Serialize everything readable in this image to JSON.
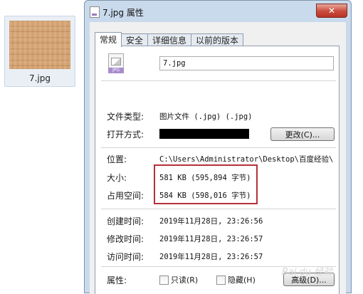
{
  "desktop": {
    "thumbnail_label": "7.jpg"
  },
  "window": {
    "title": "7.jpg 属性",
    "close_glyph": "✕"
  },
  "tabs": [
    {
      "label": "常规",
      "active": true
    },
    {
      "label": "安全",
      "active": false
    },
    {
      "label": "详细信息",
      "active": false
    },
    {
      "label": "以前的版本",
      "active": false
    }
  ],
  "general": {
    "file_icon_band": "JPG",
    "file_name": "7.jpg",
    "file_type_label": "文件类型:",
    "file_type_value": "图片文件 (.jpg) (.jpg)",
    "opens_with_label": "打开方式:",
    "change_button": "更改(C)...",
    "location_label": "位置:",
    "location_value": "C:\\Users\\Administrator\\Desktop\\百度经验\\",
    "size_label": "大小:",
    "size_value": "581 KB (595,894 字节)",
    "size_on_disk_label": "占用空间:",
    "size_on_disk_value": "584 KB (598,016 字节)",
    "created_label": "创建时间:",
    "created_value": "2019年11月28日, 23:26:56",
    "modified_label": "修改时间:",
    "modified_value": "2019年11月28日, 23:26:57",
    "accessed_label": "访问时间:",
    "accessed_value": "2019年11月28日, 23:26:57",
    "attributes_label": "属性:",
    "readonly_label": "只读(R)",
    "hidden_label": "隐藏(H)",
    "advanced_button": "高级(D)..."
  },
  "watermark": "Bai du 经验",
  "colors": {
    "highlight_border": "#b3313b",
    "window_frame": "#c9daec"
  }
}
